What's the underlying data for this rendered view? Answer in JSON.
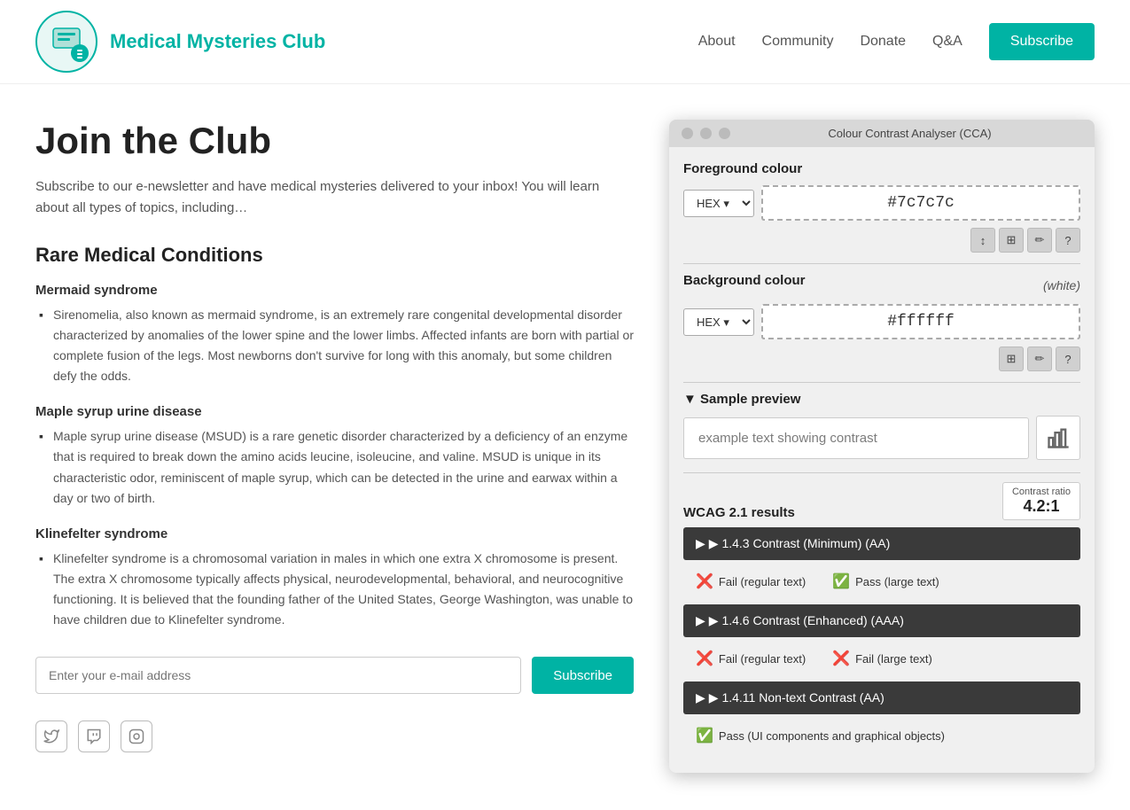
{
  "navbar": {
    "brand_name": "Medical Mysteries Club",
    "links": [
      {
        "label": "About",
        "id": "about"
      },
      {
        "label": "Community",
        "id": "community"
      },
      {
        "label": "Donate",
        "id": "donate"
      },
      {
        "label": "Q&A",
        "id": "qa"
      }
    ],
    "subscribe_label": "Subscribe"
  },
  "main": {
    "page_title": "Join the Club",
    "intro": "Subscribe to our e-newsletter and have medical mysteries delivered to your inbox! You will learn about all types of topics, including…",
    "section_title": "Rare Medical Conditions",
    "conditions": [
      {
        "title": "Mermaid syndrome",
        "description": "Sirenomelia, also known as mermaid syndrome, is an extremely rare congenital developmental disorder characterized by anomalies of the lower spine and the lower limbs. Affected infants are born with partial or complete fusion of the legs. Most newborns don't survive for long with this anomaly, but some children defy the odds."
      },
      {
        "title": "Maple syrup urine disease",
        "description": "Maple syrup urine disease (MSUD) is a rare genetic disorder characterized by a deficiency of an enzyme that is required to break down the amino acids leucine, isoleucine, and valine. MSUD is unique in its characteristic odor, reminiscent of maple syrup, which can be detected in the urine and earwax within a day or two of birth."
      },
      {
        "title": "Klinefelter syndrome",
        "description": "Klinefelter syndrome is a chromosomal variation in males in which one extra X chromosome is present. The extra X chromosome typically affects physical, neurodevelopmental, behavioral, and neurocognitive functioning. It is believed that the founding father of the United States, George Washington, was unable to have children due to Klinefelter syndrome."
      }
    ],
    "email_placeholder": "Enter your e-mail address",
    "subscribe_btn_label": "Subscribe"
  },
  "cca": {
    "window_title": "Colour Contrast Analyser (CCA)",
    "foreground_label": "Foreground colour",
    "foreground_format": "HEX",
    "foreground_value": "#7c7c7c",
    "background_label": "Background colour",
    "background_white_label": "(white)",
    "background_format": "HEX",
    "background_value": "#ffffff",
    "sample_preview_label": "▼ Sample preview",
    "sample_text": "example text showing contrast",
    "wcag_label": "WCAG 2.1 results",
    "contrast_ratio_label": "Contrast ratio",
    "contrast_ratio_value": "4.2:1",
    "wcag_rows": [
      {
        "id": "1.4.3",
        "label": "▶  1.4.3 Contrast (Minimum) (AA)",
        "results": [
          {
            "icon": "fail",
            "text": "Fail (regular text)"
          },
          {
            "icon": "pass",
            "text": "Pass (large text)"
          }
        ]
      },
      {
        "id": "1.4.6",
        "label": "▶  1.4.6 Contrast (Enhanced) (AAA)",
        "results": [
          {
            "icon": "fail",
            "text": "Fail (regular text)"
          },
          {
            "icon": "fail",
            "text": "Fail (large text)"
          }
        ]
      },
      {
        "id": "1.4.11",
        "label": "▶  1.4.11 Non-text Contrast (AA)",
        "results": [
          {
            "icon": "pass",
            "text": "Pass (UI components and graphical objects)"
          }
        ]
      }
    ],
    "toolbar_icons": [
      "↕",
      "⊞",
      "✏",
      "?"
    ],
    "bg_toolbar_icons": [
      "⊞",
      "✏",
      "?"
    ]
  }
}
